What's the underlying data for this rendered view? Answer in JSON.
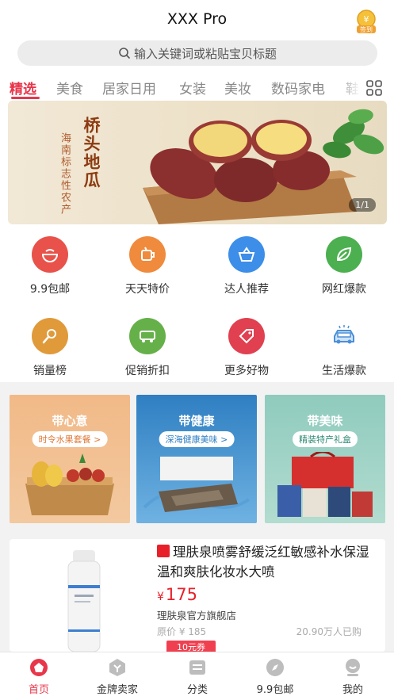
{
  "header": {
    "title": "XXX Pro",
    "signin_label": "签到"
  },
  "search": {
    "placeholder": "输入关键词或粘贴宝贝标题"
  },
  "tabs": [
    "精选",
    "美食",
    "居家日用",
    "女装",
    "美妆",
    "数码家电",
    "鞋"
  ],
  "banner": {
    "title": "桥头地瓜",
    "subtitle": "海南标志性农产",
    "pager": "1/1"
  },
  "categories": [
    {
      "label": "9.9包邮",
      "icon": "bowl-icon",
      "color": "#e8524a"
    },
    {
      "label": "天天特价",
      "icon": "cup-icon",
      "color": "#f08a3c"
    },
    {
      "label": "达人推荐",
      "icon": "basket-icon",
      "color": "#3d8ee8"
    },
    {
      "label": "网红爆款",
      "icon": "leaf-icon",
      "color": "#4caf50"
    },
    {
      "label": "销量榜",
      "icon": "microphone-icon",
      "color": "#e09a3a"
    },
    {
      "label": "促销折扣",
      "icon": "truck-icon",
      "color": "#66b04a"
    },
    {
      "label": "更多好物",
      "icon": "tag-icon",
      "color": "#e04050"
    },
    {
      "label": "生活爆款",
      "icon": "car-wash-icon",
      "color": "#4a90d9"
    }
  ],
  "promos": [
    {
      "title": "带心意",
      "pill": "时令水果套餐 >"
    },
    {
      "title": "带健康",
      "pill": "深海健康美味 >"
    },
    {
      "title": "带美味",
      "pill": "精装特产礼盒"
    }
  ],
  "product": {
    "badge": "天猫",
    "title": "理肤泉喷雾舒缓泛红敏感补水保湿温和爽肤化妆水大喷",
    "currency": "¥",
    "price": "175",
    "shop": "理肤泉官方旗舰店",
    "original_price": "原价 ¥ 185",
    "sold": "20.90万人已购",
    "coupon": "10元券"
  },
  "nav": [
    {
      "label": "首页",
      "icon": "home-icon",
      "active": true
    },
    {
      "label": "金牌卖家",
      "icon": "seller-icon"
    },
    {
      "label": "分类",
      "icon": "category-icon"
    },
    {
      "label": "9.9包邮",
      "icon": "compass-icon"
    },
    {
      "label": "我的",
      "icon": "profile-icon"
    }
  ],
  "colors": {
    "accent": "#e8364b",
    "price": "#e8202a"
  }
}
